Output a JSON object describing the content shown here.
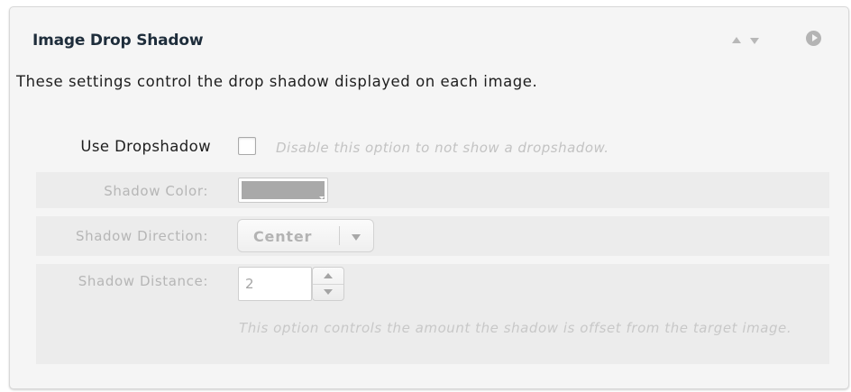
{
  "panel": {
    "title": "Image Drop Shadow",
    "description": "These settings control the drop shadow displayed on each image.",
    "header_icons": [
      "arrow-up-icon",
      "arrow-down-icon",
      "play-circle-icon"
    ]
  },
  "fields": {
    "use_dropshadow": {
      "label": "Use Dropshadow",
      "checked": false,
      "hint": "Disable this option to not show a dropshadow."
    },
    "shadow_color": {
      "label": "Shadow Color:",
      "value": "#a9a9a9"
    },
    "shadow_direction": {
      "label": "Shadow Direction:",
      "value": "Center"
    },
    "shadow_distance": {
      "label": "Shadow Distance:",
      "value": "2",
      "hint": "This option controls the amount the shadow is offset from the target image."
    }
  },
  "colors": {
    "panel_background": "#f5f5f5",
    "row_background": "#ececec",
    "title_text": "#1e2d3b",
    "disabled_text": "#b6b6b6"
  }
}
